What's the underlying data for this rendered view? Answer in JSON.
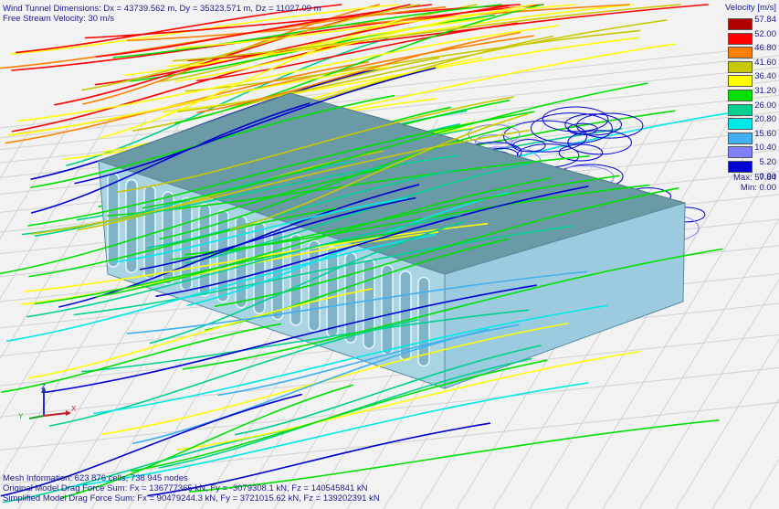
{
  "header": {
    "dimensions": "Wind Tunnel Dimensions: Dx = 43739.562 m, Dy = 35323.571 m, Dz = 11027.09 m",
    "velocity": "Free Stream Velocity: 30 m/s"
  },
  "legend": {
    "title": "Velocity [m/s]",
    "labels": [
      "57.84",
      "52.00",
      "46.80",
      "41.60",
      "36.40",
      "31.20",
      "26.00",
      "20.80",
      "15.60",
      "10.40",
      "5.20",
      "0.00"
    ],
    "colors": [
      "#b00000",
      "#ff0000",
      "#ff8000",
      "#c8c800",
      "#ffff00",
      "#00e000",
      "#00d090",
      "#00e8e8",
      "#40b0f0",
      "#8080ff",
      "#0000d0"
    ],
    "max": "Max: 57.84",
    "min": "Min: 0.00"
  },
  "footer": {
    "mesh": "Mesh Information: 623 876 cells, 738 945 nodes",
    "original": "Original Model Drag Force Sum: Fx = 136777365 kN, Fy = -3079308.1 kN, Fz = 140545841 kN",
    "simplified": "Simplified Model Drag Force Sum: Fx = 90479244.3 kN, Fy = 3721015.62 kN, Fz = 139202391 kN"
  },
  "axes": {
    "x": "X",
    "y": "Y",
    "z": "Z"
  }
}
